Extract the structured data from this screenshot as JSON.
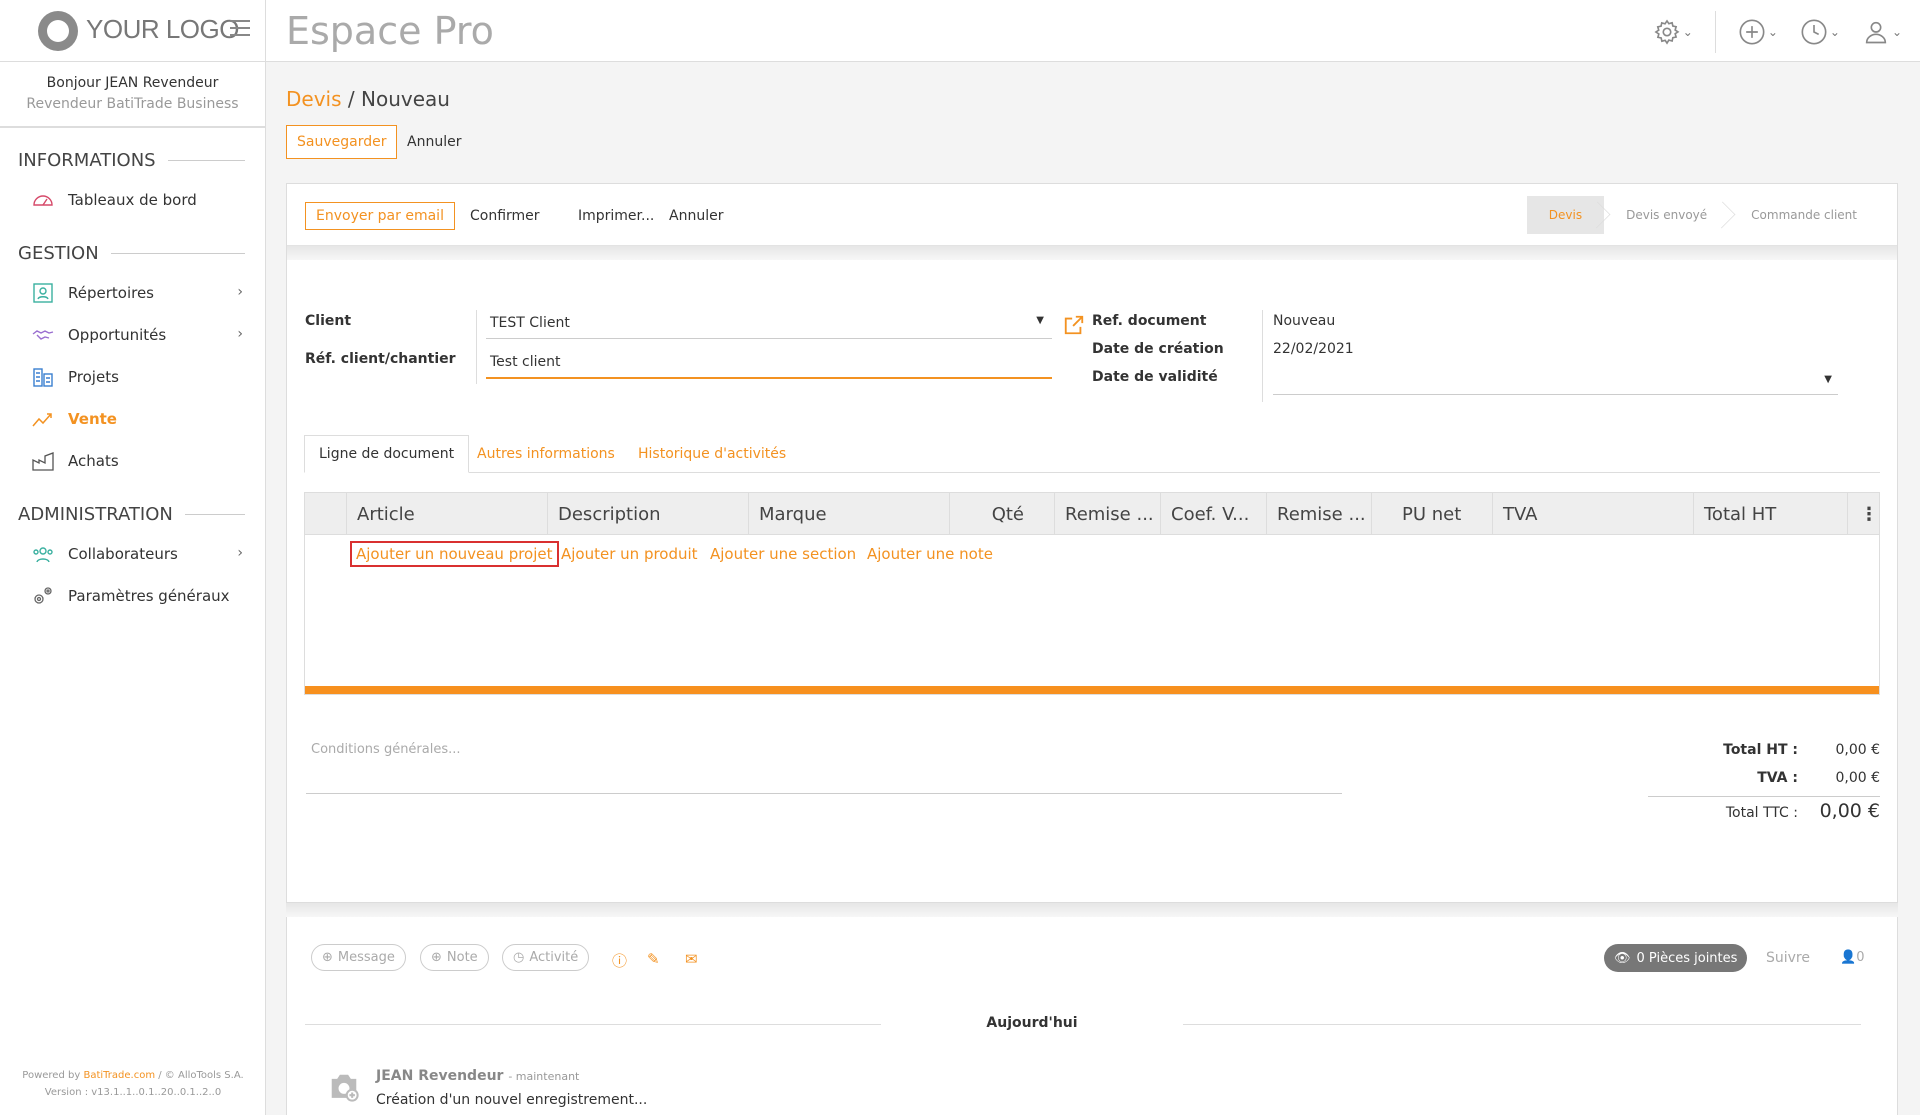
{
  "topbar": {
    "logo": "YOUR LOGO",
    "title": "Espace Pro",
    "icons": [
      "gear-icon",
      "plus-icon",
      "clock-icon",
      "user-icon"
    ]
  },
  "sidebar": {
    "greeting": "Bonjour JEAN Revendeur",
    "role": "Revendeur BatiTrade Business",
    "sections": {
      "informations": "INFORMATIONS",
      "gestion": "GESTION",
      "administration": "ADMINISTRATION"
    },
    "items": {
      "tableaux": "Tableaux de bord",
      "repertoires": "Répertoires",
      "opportunites": "Opportunités",
      "projets": "Projets",
      "vente": "Vente",
      "achats": "Achats",
      "collaborateurs": "Collaborateurs",
      "parametres": "Paramètres généraux"
    },
    "powered_prefix": "Powered by",
    "powered_brand": "BatiTrade.com",
    "powered_suffix": "/ © AlloTools S.A.",
    "version": "Version : v13.1..1..0.1..20..0.1..2..0"
  },
  "breadcrumb": {
    "parent": "Devis",
    "sep": "/",
    "current": "Nouveau"
  },
  "actions": {
    "save": "Sauvegarder",
    "cancel": "Annuler"
  },
  "toolbar": {
    "email": "Envoyer par email",
    "confirm": "Confirmer",
    "print": "Imprimer...",
    "cancel": "Annuler",
    "stages": [
      "Devis",
      "Devis envoyé",
      "Commande client"
    ]
  },
  "form": {
    "client_label": "Client",
    "client_value": "TEST Client",
    "ref_client_label": "Réf. client/chantier",
    "ref_client_value": "Test client",
    "ref_doc_label": "Ref. document",
    "ref_doc_value": "Nouveau",
    "date_creation_label": "Date de création",
    "date_creation_value": "22/02/2021",
    "date_validite_label": "Date de validité",
    "date_validite_value": ""
  },
  "tabs": [
    "Ligne de document",
    "Autres informations",
    "Historique d'activités"
  ],
  "table": {
    "columns": [
      "Article",
      "Description",
      "Marque",
      "Qté",
      "Remise ...",
      "Coef. V...",
      "Remise ...",
      "PU net",
      "TVA",
      "Total HT"
    ],
    "add_links": [
      "Ajouter un nouveau projet",
      "Ajouter un produit",
      "Ajouter une section",
      "Ajouter une note"
    ]
  },
  "conditions_placeholder": "Conditions générales...",
  "totals": {
    "ht_label": "Total HT :",
    "ht_value": "0,00 €",
    "tva_label": "TVA :",
    "tva_value": "0,00 €",
    "ttc_label": "Total TTC :",
    "ttc_value": "0,00 €"
  },
  "chatter": {
    "message": "Message",
    "note": "Note",
    "activite": "Activité",
    "attachments": "0 Pièces jointes",
    "follow": "Suivre",
    "followers": "0",
    "today": "Aujourd'hui",
    "author": "JEAN Revendeur",
    "time": "- maintenant",
    "text": "Création d'un nouvel enregistrement..."
  },
  "colors": {
    "accent": "#f39221",
    "highlight": "#d93030"
  }
}
